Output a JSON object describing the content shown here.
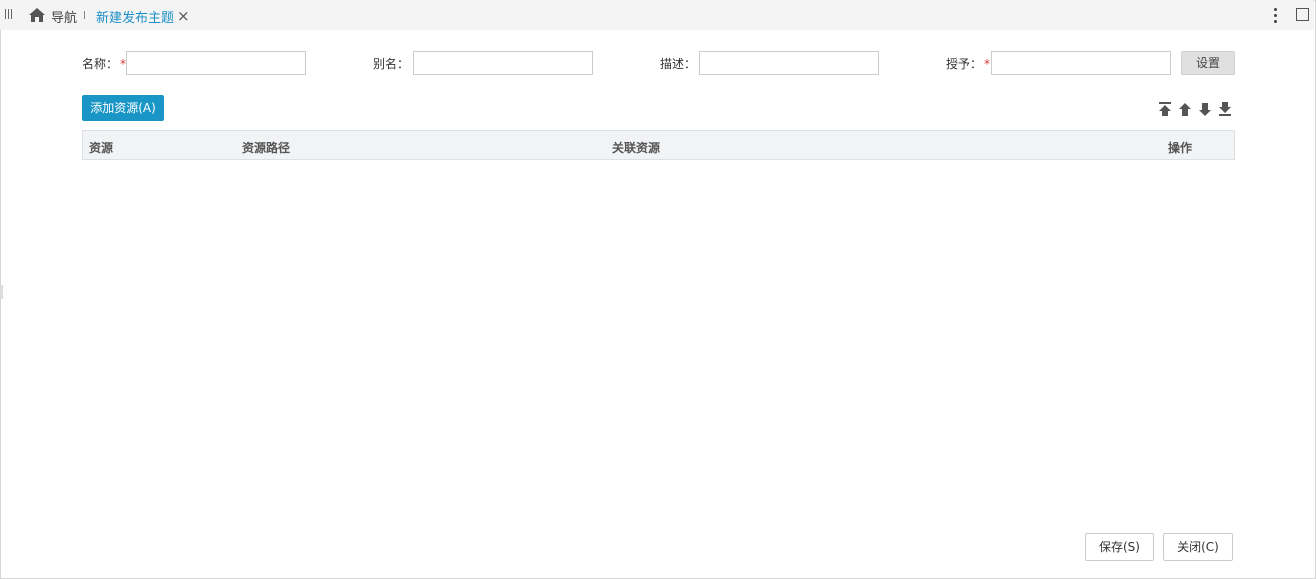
{
  "tabbar": {
    "nav_label": "导航",
    "active_tab_label": "新建发布主题",
    "close_glyph": "×"
  },
  "form": {
    "name_label": "名称：",
    "alias_label": "别名：",
    "desc_label": "描述：",
    "grant_label": "授予：",
    "required_mark": "*",
    "name_value": "",
    "alias_value": "",
    "desc_value": "",
    "grant_value": "",
    "settings_button": "设置"
  },
  "toolbar": {
    "add_resource_button": "添加资源(A)"
  },
  "table": {
    "columns": [
      "资源",
      "资源路径",
      "关联资源",
      "操作"
    ],
    "rows": []
  },
  "footer": {
    "save_button": "保存(S)",
    "close_button": "关闭(C)"
  },
  "colors": {
    "accent": "#1a96c6",
    "tab_active_text": "#1a8fc6",
    "required": "#e4393c",
    "header_bg": "#f2f3f5"
  }
}
